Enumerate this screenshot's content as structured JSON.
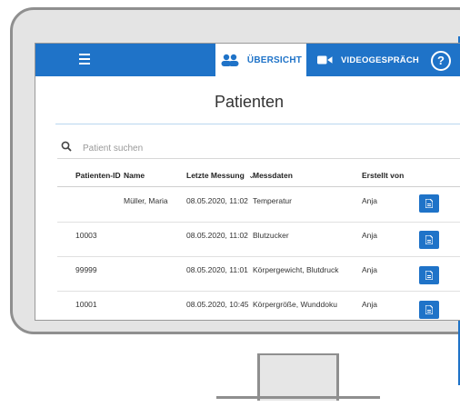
{
  "topbar": {
    "overview_label": "ÜBERSICHT",
    "video_label": "VIDEOGESPRÄCH",
    "help_symbol": "?"
  },
  "page": {
    "title": "Patienten"
  },
  "search": {
    "placeholder": "Patient suchen"
  },
  "table": {
    "headers": {
      "patient_id": "Patienten-ID",
      "name": "Name",
      "last_measurement": "Letzte Messung",
      "sort_indicator": "⌄",
      "data": "Messdaten",
      "created_by": "Erstellt von"
    },
    "rows": [
      {
        "patient_id": "",
        "name": "Müller, Maria",
        "last_measurement": "08.05.2020, 11:02",
        "data": "Temperatur",
        "created_by": "Anja"
      },
      {
        "patient_id": "10003",
        "name": "",
        "last_measurement": "08.05.2020, 11:02",
        "data": "Blutzucker",
        "created_by": "Anja"
      },
      {
        "patient_id": "99999",
        "name": "",
        "last_measurement": "08.05.2020, 11:01",
        "data": "Körpergewicht, Blutdruck",
        "created_by": "Anja"
      },
      {
        "patient_id": "10001",
        "name": "",
        "last_measurement": "08.05.2020, 10:45",
        "data": "Körpergröße, Wunddoku",
        "created_by": "Anja"
      }
    ]
  },
  "colors": {
    "primary": "#1f73c8",
    "bezel": "#e4e4e4",
    "bezel_stroke": "#8f8f8f"
  },
  "icons": {
    "menu": "menu-icon",
    "overview": "users-icon",
    "video": "video-camera-icon",
    "help": "help-icon",
    "search": "search-icon",
    "document": "document-icon"
  }
}
